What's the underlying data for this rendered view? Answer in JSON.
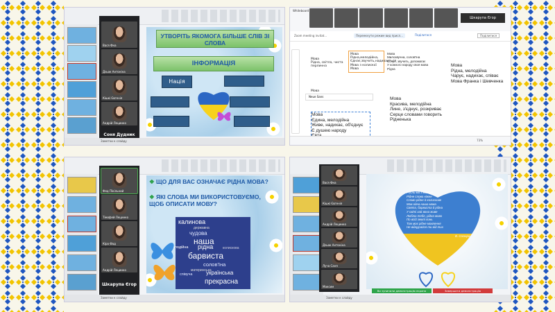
{
  "colors": {
    "blue": "#2c67c4",
    "yellow": "#f7d21c",
    "green_banner": "#7cc26a",
    "slide_blue": "#2f5d8a"
  },
  "panel1": {
    "participants": [
      {
        "name": "Вася Фна"
      },
      {
        "name": "Дзьок Антоніна"
      },
      {
        "name": "Кішкі Євгенія"
      },
      {
        "name": "Андрій Лецинко"
      }
    ],
    "speaker": "Соня Дудник",
    "slide": {
      "title": "УТВОРІТЬ ЯКОМОГА БІЛЬШЕ СЛІВ ЗІ СЛОВА",
      "word": "ІНФОРМАЦІЯ",
      "box_label": "Нація"
    },
    "status": "Заметки к слайду"
  },
  "panel2": {
    "app_label": "Whiteboard",
    "meeting_title": "Zoom meeting invitat...",
    "top_right_name": "Шкарупа Єгор",
    "toolbar_left": "Перемкнути режим вид присл...",
    "toolbar_btn": "Поділитися",
    "share_btn": "Поділитися",
    "notes": [
      {
        "text": "Мова\nРідна, світла, чиста\nперлинна"
      },
      {
        "text": "Мова\nРідна,мелодійна,\nЄднає,звучить,надихається\nМова з колискої\nМова"
      },
      {
        "text": "Мова"
      }
    ],
    "text_blocks": [
      {
        "text": "Мова\nМилозвучна, солов'їна\nЄснує, звучить, допомагає\nУ кожного народу своя мова\nРідна"
      },
      {
        "text": "Мова\nРідна, мелодійна\nЧарує, надихає, співає\nМова Франка і Шевченка"
      },
      {
        "text": "Мова\nКрасива, мелодійна\nЛине, з'єднує, розкриває\nСерце словами говорить\nРідненька"
      },
      {
        "text": "Мова\nЄдина, мелодійна\nЖиве, надихає, об'єднує\nЄ душею народу\nЄвта"
      }
    ],
    "font_name": "Neue Sans",
    "zoom": "73%"
  },
  "panel3": {
    "participants": [
      {
        "name": "Фед Пікільний"
      },
      {
        "name": "Тімофей Лецинко"
      },
      {
        "name": "Кіра Фад"
      },
      {
        "name": "Андрій Лецинко"
      }
    ],
    "speaker": "Шкарупа Єгор",
    "slide": {
      "q1": "ЩО ДЛЯ ВАС ОЗНАЧАЄ РІДНА МОВА?",
      "q2": "ЯКІ СЛОВА МИ ВИКОРИСТОВУЄМО, ЩОБ ОПИСАТИ МОВУ?",
      "cloud": [
        "калинова",
        "державна",
        "чудова",
        "наша",
        "мелодійна",
        "рідна",
        "колискова",
        "барвиста",
        "солов'їна",
        "материнська",
        "українська",
        "співуча",
        "прекрасна"
      ]
    },
    "status": "Заметки к слайду"
  },
  "panel4": {
    "participants": [
      {
        "name": "Вася Фна"
      },
      {
        "name": "Кішкі Євгенія"
      },
      {
        "name": "Андрій Лецинко"
      },
      {
        "name": "Дзьок Антоніна"
      },
      {
        "name": "Луча Саня"
      },
      {
        "name": "Максим"
      }
    ],
    "poem": "Росли ми з мамою\nРідне слово ніжне\nСлово рідне й колискове\nМов одна наша мова\nСвята, барвиста й рідна\nУ світі хай вона живе\nЛюблю тебе, рідна мово\nПо всій землі линь\nТож моє рідне мовлення\nНе відцурайся ти від тих",
    "author": "В. Сосюра",
    "btn_green": "Ви зупинили демонстрацію екрана",
    "btn_red": "Завершити демонстрацію",
    "status": "Заметки к слайду"
  }
}
